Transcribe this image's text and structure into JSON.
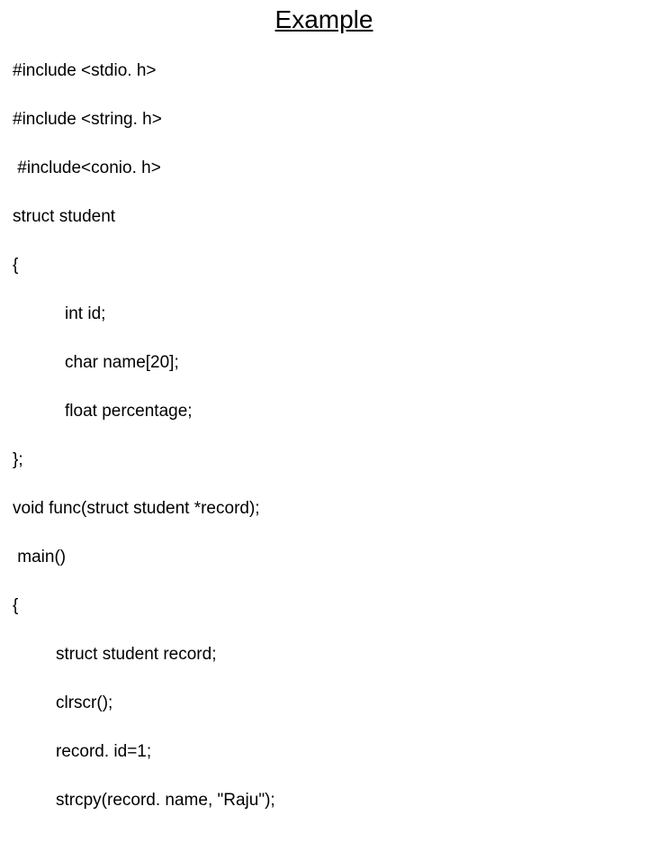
{
  "title": "Example",
  "code": {
    "l1": "#include <stdio. h>",
    "l2": "#include <string. h>",
    "l3": " #include<conio. h>",
    "l4": "struct student",
    "l5": "{",
    "l6": "int id;",
    "l7": "char name[20];",
    "l8": "float percentage;",
    "l9": "};",
    "l10": "void func(struct student *record);",
    "l11": " main()",
    "l12": "{",
    "l13": "struct student record;",
    "l14": "clrscr();",
    "l15": "record. id=1;",
    "l16": "strcpy(record. name, \"Raju\");"
  }
}
